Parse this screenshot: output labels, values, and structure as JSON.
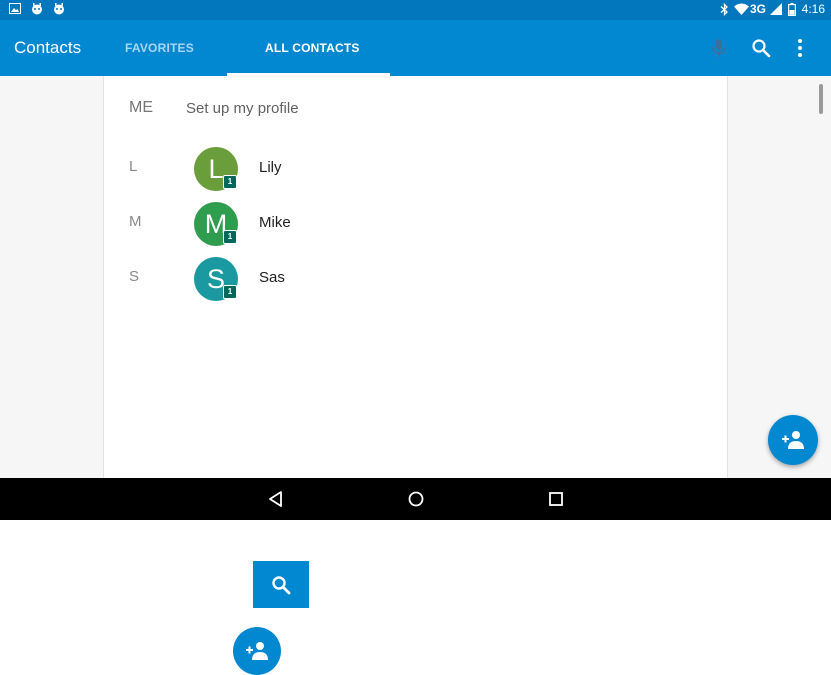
{
  "status_bar": {
    "network": "3G",
    "time": "4:16"
  },
  "toolbar": {
    "title": "Contacts",
    "tabs": [
      {
        "label": "FAVORITES",
        "selected": false
      },
      {
        "label": "ALL CONTACTS",
        "selected": true
      }
    ],
    "icons": [
      "microphone-icon",
      "search-icon",
      "overflow-menu-icon"
    ]
  },
  "profile": {
    "label": "ME",
    "action": "Set up my profile"
  },
  "contacts": [
    {
      "section": "L",
      "initial": "L",
      "name": "Lily",
      "badge": "1",
      "color": "#6a9e3a"
    },
    {
      "section": "M",
      "initial": "M",
      "name": "Mike",
      "badge": "1",
      "color": "#2e9d4e"
    },
    {
      "section": "S",
      "initial": "S",
      "name": "Sas",
      "badge": "1",
      "color": "#1a9aa0"
    }
  ],
  "fab": {
    "icon": "add-contact-icon"
  },
  "nav": {
    "icons": [
      "back-icon",
      "home-icon",
      "recents-icon"
    ]
  },
  "colors": {
    "status_bar": "#0277bd",
    "toolbar": "#0288d1",
    "accent": "#0288d1"
  }
}
